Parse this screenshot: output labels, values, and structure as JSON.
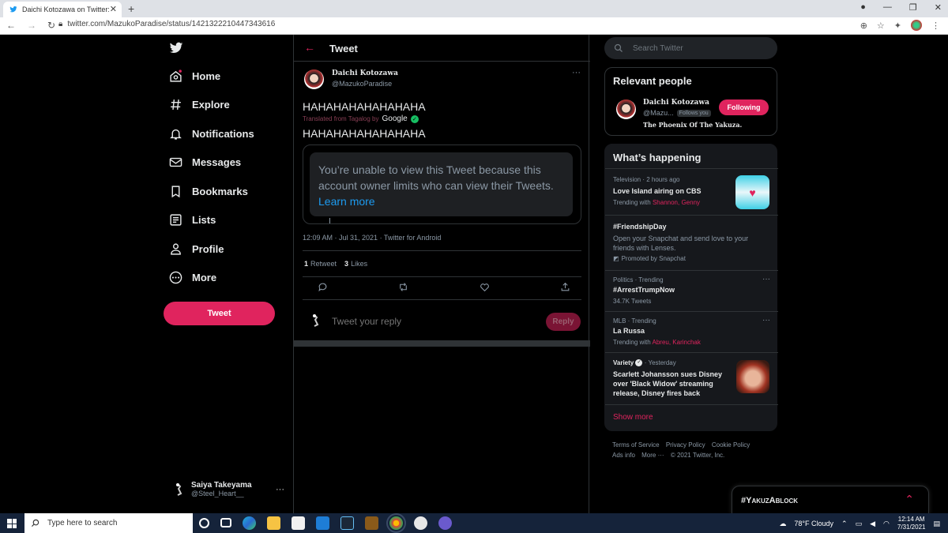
{
  "browser": {
    "tab_title": "Daichi Kotozawa on Twitter: \"HAHAHAHAHAHAHAHA\"",
    "url": "twitter.com/MazukoParadise/status/1421322210447343616"
  },
  "nav": {
    "items": [
      {
        "label": "Home",
        "icon": "home-icon"
      },
      {
        "label": "Explore",
        "icon": "hashtag-icon"
      },
      {
        "label": "Notifications",
        "icon": "bell-icon"
      },
      {
        "label": "Messages",
        "icon": "mail-icon"
      },
      {
        "label": "Bookmarks",
        "icon": "bookmark-icon"
      },
      {
        "label": "Lists",
        "icon": "list-icon"
      },
      {
        "label": "Profile",
        "icon": "person-icon"
      },
      {
        "label": "More",
        "icon": "more-circle-icon"
      }
    ],
    "tweet_button": "Tweet",
    "account": {
      "name": "Saiya Takeyama",
      "handle": "@Steel_Heart__",
      "more": "···"
    }
  },
  "main": {
    "header_title": "Tweet",
    "tweet": {
      "author_name": "Daichi Kotozawa",
      "author_handle": "@MazukoParadise",
      "more": "···",
      "text": "HAHAHAHAHAHAHAHA",
      "translated_from": "Translated from Tagalog by",
      "translator": "Google",
      "translated_text": "HAHAHAHAHAHAHAHA",
      "quote_notice": "You’re unable to view this Tweet because this account owner limits who can view their Tweets.",
      "quote_link": "Learn more",
      "timestamp": "12:09 AM · Jul 31, 2021 · Twitter for Android",
      "retweets_count": "1",
      "retweets_label": "Retweet",
      "likes_count": "3",
      "likes_label": "Likes"
    },
    "reply": {
      "placeholder": "Tweet your reply",
      "button": "Reply"
    }
  },
  "sidebar": {
    "search_placeholder": "Search Twitter",
    "relevant": {
      "title": "Relevant people",
      "name": "Daichi Kotozawa",
      "handle": "@Mazu...",
      "follows_you": "Follows you",
      "button": "Following",
      "bio": "The Phoenix Of The Yakuza."
    },
    "happening": {
      "title": "What’s happening",
      "trends": [
        {
          "meta": "Television · 2 hours ago",
          "title": "Love Island airing on CBS",
          "sub_prefix": "Trending with",
          "sub_pink": "Shannon, Genny"
        },
        {
          "meta": "",
          "title": "#FriendshipDay",
          "desc": "Open your Snapchat and send love to your friends with Lenses.",
          "promoted": "Promoted by Snapchat"
        },
        {
          "meta": "Politics · Trending",
          "title": "#ArrestTrumpNow",
          "sub": "34.7K Tweets"
        },
        {
          "meta": "MLB · Trending",
          "title": "La Russa",
          "sub_prefix": "Trending with",
          "sub_pink": "Abreu, Karinchak"
        },
        {
          "source": "Variety",
          "meta": "· Yesterday",
          "title": "Scarlett Johansson sues Disney over 'Black Widow' streaming release, Disney fires back"
        }
      ],
      "show_more": "Show more"
    },
    "footer": [
      "Terms of Service",
      "Privacy Policy",
      "Cookie Policy",
      "Ads info",
      "More ···",
      "© 2021 Twitter, Inc."
    ]
  },
  "floating": {
    "title": "#YakuzAblock"
  },
  "taskbar": {
    "search_placeholder": "Type here to search",
    "weather": "78°F  Cloudy",
    "time": "12:14 AM",
    "date": "7/31/2021"
  },
  "colors": {
    "accent": "#e0245e",
    "link": "#1d9bf0",
    "background": "#000000"
  }
}
